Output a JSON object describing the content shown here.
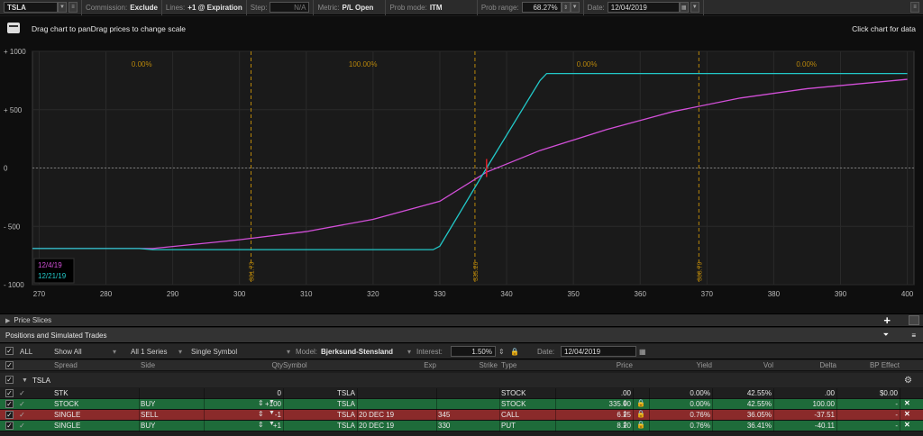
{
  "toolbar": {
    "symbol": "TSLA",
    "commission_label": "Commission:",
    "commission_value": "Exclude",
    "lines_label": "Lines:",
    "lines_value": "+1 @ Expiration",
    "step_label": "Step:",
    "step_value": "N/A",
    "metric_label": "Metric:",
    "metric_value": "P/L Open",
    "probmode_label": "Prob mode:",
    "probmode_value": "ITM",
    "probrange_label": "Prob range:",
    "probrange_value": "68.27%",
    "date_label": "Date:",
    "date_value": "12/04/2019"
  },
  "chart": {
    "hint_left": "Drag chart to panDrag prices to change scale",
    "hint_right": "Click chart for data",
    "legend": [
      "12/4/19",
      "12/21/19"
    ],
    "colors": {
      "series1": "#d24fd8",
      "series2": "#22c8c8",
      "marker": "#e0202a",
      "vline": "#b8860b"
    },
    "prob_labels": [
      "0.00%",
      "100.00%",
      "0.00%",
      "0.00%"
    ],
    "vline_labels": [
      "301.73",
      "335.26",
      "368.79"
    ]
  },
  "chart_data": {
    "type": "line",
    "x_ticks": [
      270,
      280,
      290,
      300,
      310,
      320,
      330,
      340,
      350,
      360,
      370,
      380,
      390,
      400
    ],
    "y_ticks": [
      "+ 1000",
      "+ 500",
      "0",
      "- 500",
      "- 1000"
    ],
    "xlim": [
      269,
      401
    ],
    "ylim": [
      -1000,
      1000
    ],
    "vlines": [
      301.73,
      335.26,
      368.79
    ],
    "series": [
      {
        "name": "12/4/19",
        "x": [
          269,
          287,
          300,
          310,
          320,
          330,
          337,
          345,
          355,
          365,
          375,
          385,
          400
        ],
        "y": [
          -690,
          -690,
          -615,
          -545,
          -440,
          -285,
          -35,
          150,
          330,
          485,
          600,
          680,
          760
        ]
      },
      {
        "name": "12/21/19",
        "x": [
          269,
          285,
          287,
          329,
          330,
          337,
          345,
          346,
          400
        ],
        "y": [
          -690,
          -690,
          -700,
          -700,
          -670,
          0,
          750,
          810,
          810
        ]
      }
    ],
    "marker": {
      "x": 337,
      "y": 0
    }
  },
  "sections": {
    "price_slices": "Price Slices",
    "positions": "Positions and Simulated Trades"
  },
  "controls": {
    "all": "ALL",
    "show_all": "Show All",
    "series": "All 1 Series",
    "single_symbol": "Single Symbol",
    "model_label": "Model:",
    "model_value": "Bjerksund-Stensland",
    "interest_label": "Interest:",
    "interest_value": "1.50%",
    "date_label": "Date:",
    "date_value": "12/04/2019"
  },
  "table": {
    "headers": {
      "spread": "Spread",
      "side": "Side",
      "qty": "Qty",
      "symbol": "Symbol",
      "exp": "Exp",
      "strike": "Strike",
      "type": "Type",
      "price": "Price",
      "yield": "Yield",
      "vol": "Vol",
      "delta": "Delta",
      "bp": "BP Effect"
    },
    "group": "TSLA",
    "rows": [
      {
        "spread": "STK",
        "side": "",
        "qty": "0",
        "symbol": "TSLA",
        "exp": "",
        "strike": "",
        "type": "STOCK",
        "price": ".00",
        "yield": "0.00%",
        "vol": "42.55%",
        "delta": ".00",
        "bp": "$0.00",
        "bg": "#1f1f1f"
      },
      {
        "spread": "STOCK",
        "side": "BUY",
        "qty": "+100",
        "symbol": "TSLA",
        "exp": "",
        "strike": "",
        "type": "STOCK",
        "price": "335.00",
        "yield": "0.00%",
        "vol": "42.55%",
        "delta": "100.00",
        "bp": "-",
        "bg": "#1e6b3a"
      },
      {
        "spread": "SINGLE",
        "side": "SELL",
        "qty": "-1",
        "symbol": "TSLA",
        "exp": "20 DEC 19",
        "strike": "345",
        "type": "CALL",
        "price": "6.25",
        "yield": "0.76%",
        "vol": "36.05%",
        "delta": "-37.51",
        "bp": "-",
        "bg": "#8a2a2a"
      },
      {
        "spread": "SINGLE",
        "side": "BUY",
        "qty": "+1",
        "symbol": "TSLA",
        "exp": "20 DEC 19",
        "strike": "330",
        "type": "PUT",
        "price": "8.20",
        "yield": "0.76%",
        "vol": "36.41%",
        "delta": "-40.11",
        "bp": "-",
        "bg": "#1e6b3a"
      }
    ]
  }
}
